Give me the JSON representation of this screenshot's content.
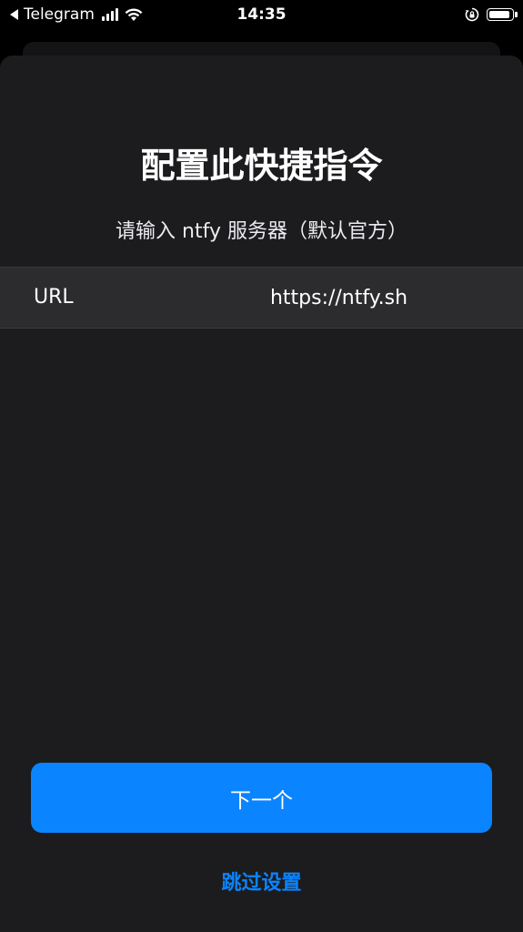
{
  "status_bar": {
    "back_app": "Telegram",
    "time": "14:35",
    "battery_level": 0.95
  },
  "sheet": {
    "title": "配置此快捷指令",
    "subtitle": "请输入 ntfy 服务器（默认官方）",
    "field": {
      "label": "URL",
      "value": "https://ntfy.sh"
    },
    "next_label": "下一个",
    "skip_label": "跳过设置",
    "accent_color": "#0a84ff"
  }
}
